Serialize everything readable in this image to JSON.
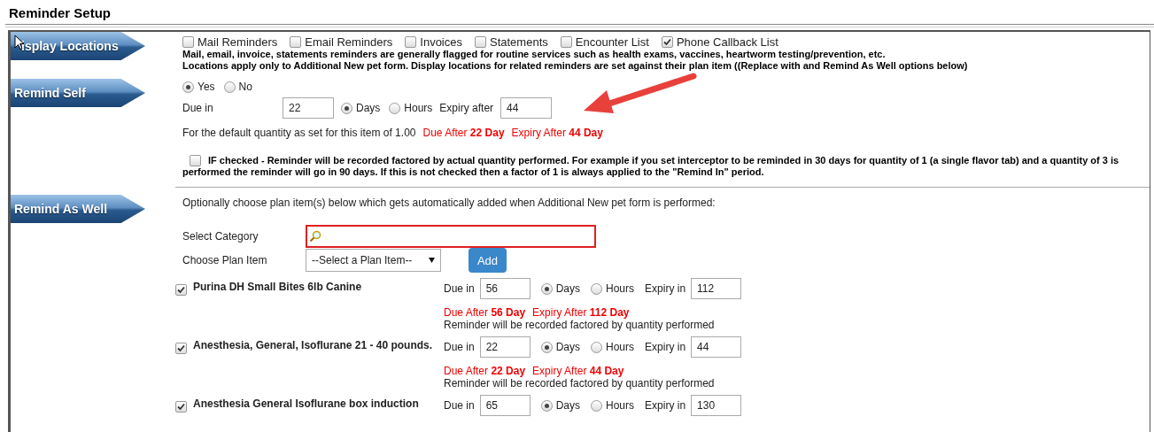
{
  "title": "Reminder Setup",
  "display_locations": {
    "label": "isplay Locations",
    "options": [
      {
        "label": "Mail Reminders",
        "checked": false
      },
      {
        "label": "Email Reminders",
        "checked": false
      },
      {
        "label": "Invoices",
        "checked": false
      },
      {
        "label": "Statements",
        "checked": false
      },
      {
        "label": "Encounter List",
        "checked": false
      },
      {
        "label": "Phone Callback List",
        "checked": true
      }
    ],
    "notes": [
      "Mail, email, invoice, statements reminders are generally flagged for routine services such as health exams, vaccines, heartworm testing/prevention, etc.",
      "Locations apply only to Additional New pet form. Display locations for related reminders are set against their plan item ((Replace with and Remind As Well options below)"
    ]
  },
  "remind_self": {
    "label": "Remind Self",
    "choices": [
      {
        "label": "Yes",
        "selected": true
      },
      {
        "label": "No",
        "selected": false
      }
    ],
    "due_label": "Due in",
    "due_value": "22",
    "units": [
      {
        "label": "Days",
        "selected": true
      },
      {
        "label": "Hours",
        "selected": false
      }
    ],
    "expiry_label": "Expiry after",
    "expiry_value": "44",
    "default_text": "For the default quantity as set for this item of 1.00",
    "due_after": "Due After **22 Day**",
    "expiry_after": "Expiry After **44 Day**",
    "factor_checked": false,
    "factor_lines": [
      "IF checked - Reminder will be recorded factored by actual quantity performed. For example if you set interceptor to be reminded in 30 days for quantity of 1 (a single flavor tab) and a quantity of 3 is",
      "performed the reminder will go in 90 days. If this is not checked then a factor of 1 is always applied to the \"Remind In\" period."
    ]
  },
  "remind_as_well": {
    "label": "Remind As Well",
    "intro": "Optionally choose plan item(s) below which gets automatically added when Additional New pet form is performed:",
    "category_label": "Select Category",
    "plan_item_label": "Choose Plan Item",
    "plan_item_select": "--Select a Plan Item--",
    "add_button": "Add",
    "items": [
      {
        "name": "Purina DH Small Bites 6lb Canine",
        "checked": true,
        "due_label": "Due in",
        "due_value": "56",
        "units": [
          {
            "label": "Days",
            "selected": true
          },
          {
            "label": "Hours",
            "selected": false
          }
        ],
        "expiry_label": "Expiry in",
        "expiry_value": "112",
        "due_after": "Due After **56 Day**",
        "expiry_after": "Expiry After **112 Day**",
        "note": "Reminder will be recorded factored by quantity performed"
      },
      {
        "name": "Anesthesia, General, Isoflurane 21 - 40 pounds.",
        "checked": true,
        "due_label": "Due in",
        "due_value": "22",
        "units": [
          {
            "label": "Days",
            "selected": true
          },
          {
            "label": "Hours",
            "selected": false
          }
        ],
        "expiry_label": "Expiry in",
        "expiry_value": "44",
        "due_after": "Due After **22 Day**",
        "expiry_after": "Expiry After **44 Day**",
        "note": "Reminder will be recorded factored by quantity performed"
      },
      {
        "name": "Anesthesia General Isoflurane box induction",
        "checked": true,
        "due_label": "Due in",
        "due_value": "65",
        "units": [
          {
            "label": "Days",
            "selected": true
          },
          {
            "label": "Hours",
            "selected": false
          }
        ],
        "expiry_label": "Expiry in",
        "expiry_value": "130"
      }
    ]
  }
}
